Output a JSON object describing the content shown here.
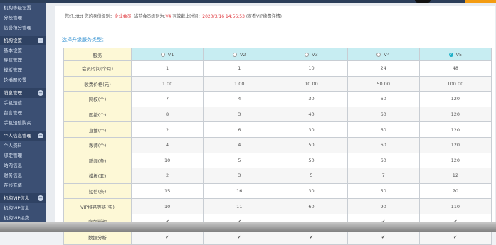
{
  "sidebar": {
    "top_items": [
      "机构等级设置",
      "分校管理",
      "信誉积分管理"
    ],
    "groups": [
      {
        "title": "机构设置",
        "items": [
          "基本设置",
          "导航管理",
          "模板管理",
          "轮播图设置"
        ]
      },
      {
        "title": "消息管理",
        "items": [
          "手机短信",
          "留言管理",
          "手机短信购买"
        ]
      },
      {
        "title": "个人信息管理",
        "items": [
          "个人资料",
          "绑定管理",
          "站内信息",
          "财务信息",
          "在线充值"
        ]
      },
      {
        "title": "机构VIP信息",
        "items": [
          "机构VIP信息",
          "机构VIP续费"
        ]
      }
    ]
  },
  "notice": {
    "prefix": "您好,ttttt 您的身份级别：",
    "level": "企业会员",
    "mid": ", 当前会员级别为:",
    "vip": "V4",
    "expire_label": " 有效截止时间：",
    "expire": "2020/3/16 14:56:53",
    "link": " (查看VIP续费详情)"
  },
  "choose_label": "选择升级服务类型：",
  "table": {
    "header_first": "服务",
    "tiers": [
      {
        "label": "V1",
        "selected": false
      },
      {
        "label": "V2",
        "selected": false
      },
      {
        "label": "V3",
        "selected": false
      },
      {
        "label": "V4",
        "selected": false
      },
      {
        "label": "V5",
        "selected": true
      }
    ],
    "rows": [
      {
        "name": "会员时间(个月)",
        "vals": [
          "1",
          "1",
          "10",
          "24",
          "48"
        ]
      },
      {
        "name": "收费价格(元)",
        "vals": [
          "1.00",
          "1.00",
          "10.00",
          "50.00",
          "100.00"
        ]
      },
      {
        "name": "网校(个)",
        "vals": [
          "7",
          "4",
          "30",
          "60",
          "120"
        ]
      },
      {
        "name": "面授(个)",
        "vals": [
          "8",
          "3",
          "40",
          "60",
          "120"
        ]
      },
      {
        "name": "直播(个)",
        "vals": [
          "2",
          "6",
          "30",
          "60",
          "120"
        ]
      },
      {
        "name": "教师(个)",
        "vals": [
          "4",
          "4",
          "50",
          "60",
          "120"
        ]
      },
      {
        "name": "新闻(条)",
        "vals": [
          "10",
          "5",
          "50",
          "60",
          "120"
        ]
      },
      {
        "name": "模板(套)",
        "vals": [
          "2",
          "3",
          "5",
          "7",
          "12"
        ]
      },
      {
        "name": "短信(条)",
        "vals": [
          "15",
          "16",
          "30",
          "50",
          "70"
        ]
      },
      {
        "name": "VIP排名等级(实)",
        "vals": [
          "10",
          "11",
          "60",
          "90",
          "110"
        ]
      },
      {
        "name": "底部版权",
        "vals": [
          "✔",
          "✔",
          "-",
          "✔",
          "✔"
        ]
      },
      {
        "name": "数据分析",
        "vals": [
          "✔",
          "✔",
          "✔",
          "✔",
          "✔"
        ]
      }
    ]
  }
}
